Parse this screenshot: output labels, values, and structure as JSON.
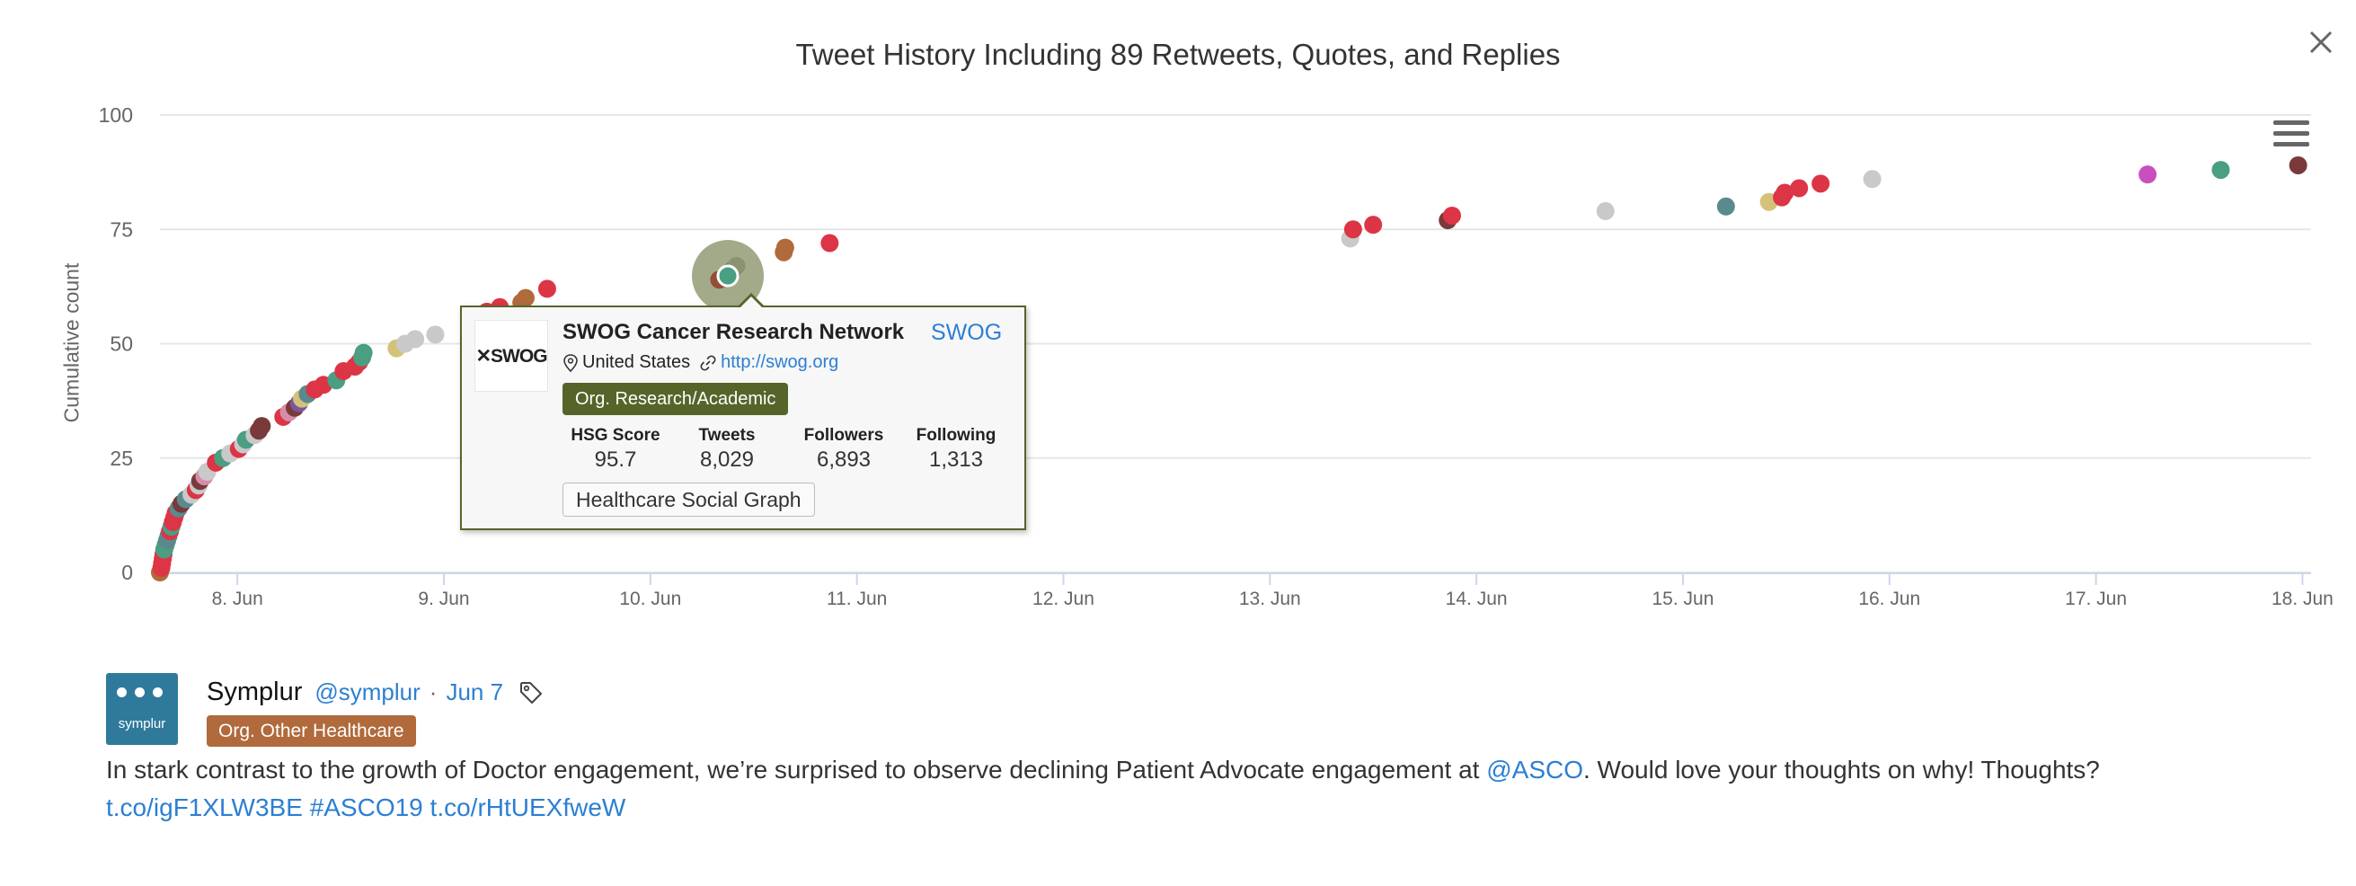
{
  "chart_data": {
    "type": "scatter",
    "title": "Tweet History Including 89 Retweets, Quotes, and Replies",
    "ylabel": "Cumulative count",
    "xlabel": "",
    "ylim": [
      0,
      100
    ],
    "xlim": [
      "2019-06-07 15:00",
      "2019-06-18 01:00"
    ],
    "y_ticks": [
      "0",
      "25",
      "50",
      "75",
      "100"
    ],
    "x_ticks": [
      "8. Jun",
      "9. Jun",
      "10. Jun",
      "11. Jun",
      "12. Jun",
      "13. Jun",
      "14. Jun",
      "15. Jun",
      "16. Jun",
      "17. Jun",
      "18. Jun"
    ],
    "grid": true,
    "highlighted_point": {
      "x": "2019-06-10 09:00",
      "y": 66
    },
    "points": [
      {
        "x": "2019-06-07 15:00",
        "y": 0,
        "color": "#b06a3b"
      },
      {
        "x": "2019-06-07 15:10",
        "y": 1,
        "color": "#dc3545"
      },
      {
        "x": "2019-06-07 15:15",
        "y": 2,
        "color": "#dc3545"
      },
      {
        "x": "2019-06-07 15:20",
        "y": 3,
        "color": "#dc3545"
      },
      {
        "x": "2019-06-07 15:25",
        "y": 4,
        "color": "#dc3545"
      },
      {
        "x": "2019-06-07 15:30",
        "y": 5,
        "color": "#4a9e82"
      },
      {
        "x": "2019-06-07 15:40",
        "y": 6,
        "color": "#4a9e82"
      },
      {
        "x": "2019-06-07 15:50",
        "y": 7,
        "color": "#5a8a8d"
      },
      {
        "x": "2019-06-07 16:00",
        "y": 8,
        "color": "#5a8a8d"
      },
      {
        "x": "2019-06-07 16:10",
        "y": 9,
        "color": "#dc3545"
      },
      {
        "x": "2019-06-07 16:20",
        "y": 10,
        "color": "#4a9e82"
      },
      {
        "x": "2019-06-07 16:30",
        "y": 11,
        "color": "#dc3545"
      },
      {
        "x": "2019-06-07 16:40",
        "y": 12,
        "color": "#dc3545"
      },
      {
        "x": "2019-06-07 16:50",
        "y": 13,
        "color": "#dc3545"
      },
      {
        "x": "2019-06-07 17:10",
        "y": 14,
        "color": "#5a8a8d"
      },
      {
        "x": "2019-06-07 17:30",
        "y": 15,
        "color": "#7a3a3a"
      },
      {
        "x": "2019-06-07 18:00",
        "y": 16,
        "color": "#5a8a8d"
      },
      {
        "x": "2019-06-07 18:40",
        "y": 17,
        "color": "#c9c9c9"
      },
      {
        "x": "2019-06-07 19:10",
        "y": 18,
        "color": "#dc3545"
      },
      {
        "x": "2019-06-07 19:30",
        "y": 19,
        "color": "#c9c9c9"
      },
      {
        "x": "2019-06-07 19:40",
        "y": 20,
        "color": "#7a3a3a"
      },
      {
        "x": "2019-06-07 20:10",
        "y": 21,
        "color": "#d58da8"
      },
      {
        "x": "2019-06-07 20:30",
        "y": 22,
        "color": "#c9c9c9"
      },
      {
        "x": "2019-06-07 21:30",
        "y": 24,
        "color": "#dc3545"
      },
      {
        "x": "2019-06-07 22:20",
        "y": 25,
        "color": "#4a9e82"
      },
      {
        "x": "2019-06-07 23:10",
        "y": 26,
        "color": "#c9c9c9"
      },
      {
        "x": "2019-06-08 00:10",
        "y": 27,
        "color": "#dc3545"
      },
      {
        "x": "2019-06-08 00:40",
        "y": 28,
        "color": "#c9c9c9"
      },
      {
        "x": "2019-06-08 01:00",
        "y": 29,
        "color": "#4a9e82"
      },
      {
        "x": "2019-06-08 02:00",
        "y": 30,
        "color": "#c9c9c9"
      },
      {
        "x": "2019-06-08 02:30",
        "y": 31,
        "color": "#7a3a3a"
      },
      {
        "x": "2019-06-08 02:50",
        "y": 32,
        "color": "#7a3a3a"
      },
      {
        "x": "2019-06-08 05:20",
        "y": 34,
        "color": "#dc3545"
      },
      {
        "x": "2019-06-08 06:00",
        "y": 35,
        "color": "#d58da8"
      },
      {
        "x": "2019-06-08 06:40",
        "y": 36,
        "color": "#7a3a3a"
      },
      {
        "x": "2019-06-08 07:10",
        "y": 37,
        "color": "#7a55a0"
      },
      {
        "x": "2019-06-08 07:30",
        "y": 38,
        "color": "#d4c27a"
      },
      {
        "x": "2019-06-08 08:10",
        "y": 39,
        "color": "#5a8a8d"
      },
      {
        "x": "2019-06-08 09:00",
        "y": 40,
        "color": "#dc3545"
      },
      {
        "x": "2019-06-08 10:00",
        "y": 41,
        "color": "#dc3545"
      },
      {
        "x": "2019-06-08 11:30",
        "y": 42,
        "color": "#4a9e82"
      },
      {
        "x": "2019-06-08 12:20",
        "y": 44,
        "color": "#dc3545"
      },
      {
        "x": "2019-06-08 13:40",
        "y": 45,
        "color": "#dc3545"
      },
      {
        "x": "2019-06-08 14:10",
        "y": 46,
        "color": "#dc3545"
      },
      {
        "x": "2019-06-08 14:30",
        "y": 47,
        "color": "#4a9e82"
      },
      {
        "x": "2019-06-08 14:40",
        "y": 48,
        "color": "#4a9e82"
      },
      {
        "x": "2019-06-08 18:30",
        "y": 49,
        "color": "#d4c27a"
      },
      {
        "x": "2019-06-08 19:30",
        "y": 50,
        "color": "#c9c9c9"
      },
      {
        "x": "2019-06-08 20:40",
        "y": 51,
        "color": "#c9c9c9"
      },
      {
        "x": "2019-06-08 23:00",
        "y": 52,
        "color": "#c9c9c9"
      },
      {
        "x": "2019-06-09 05:00",
        "y": 57,
        "color": "#dc3545"
      },
      {
        "x": "2019-06-09 06:30",
        "y": 58,
        "color": "#dc3545"
      },
      {
        "x": "2019-06-09 09:00",
        "y": 59,
        "color": "#b06a3b"
      },
      {
        "x": "2019-06-09 09:30",
        "y": 60,
        "color": "#b06a3b"
      },
      {
        "x": "2019-06-09 12:00",
        "y": 62,
        "color": "#dc3545"
      },
      {
        "x": "2019-06-10 08:00",
        "y": 64,
        "color": "#dc3545"
      },
      {
        "x": "2019-06-10 09:00",
        "y": 65,
        "color": "#4a9e82"
      },
      {
        "x": "2019-06-10 09:30",
        "y": 66,
        "color": "#4a9e82"
      },
      {
        "x": "2019-06-10 10:00",
        "y": 67,
        "color": "#c9c9c9"
      },
      {
        "x": "2019-06-10 15:30",
        "y": 70,
        "color": "#b06a3b"
      },
      {
        "x": "2019-06-10 15:40",
        "y": 71,
        "color": "#b06a3b"
      },
      {
        "x": "2019-06-10 20:50",
        "y": 72,
        "color": "#dc3545"
      },
      {
        "x": "2019-06-13 09:20",
        "y": 73,
        "color": "#c9c9c9"
      },
      {
        "x": "2019-06-13 09:40",
        "y": 75,
        "color": "#dc3545"
      },
      {
        "x": "2019-06-13 12:00",
        "y": 76,
        "color": "#dc3545"
      },
      {
        "x": "2019-06-13 20:40",
        "y": 77,
        "color": "#7a3a3a"
      },
      {
        "x": "2019-06-13 21:10",
        "y": 78,
        "color": "#dc3545"
      },
      {
        "x": "2019-06-14 15:00",
        "y": 79,
        "color": "#c9c9c9"
      },
      {
        "x": "2019-06-15 05:00",
        "y": 80,
        "color": "#5a8a8d"
      },
      {
        "x": "2019-06-15 10:00",
        "y": 81,
        "color": "#d4c27a"
      },
      {
        "x": "2019-06-15 11:30",
        "y": 82,
        "color": "#dc3545"
      },
      {
        "x": "2019-06-15 11:50",
        "y": 83,
        "color": "#dc3545"
      },
      {
        "x": "2019-06-15 13:30",
        "y": 84,
        "color": "#dc3545"
      },
      {
        "x": "2019-06-15 16:00",
        "y": 85,
        "color": "#dc3545"
      },
      {
        "x": "2019-06-15 22:00",
        "y": 86,
        "color": "#c9c9c9"
      },
      {
        "x": "2019-06-17 06:00",
        "y": 87,
        "color": "#c94fbf"
      },
      {
        "x": "2019-06-17 14:30",
        "y": 88,
        "color": "#4a9e82"
      },
      {
        "x": "2019-06-17 23:30",
        "y": 89,
        "color": "#7a3a3a"
      }
    ]
  },
  "tooltip": {
    "logo_text": "✕SWOG",
    "name": "SWOG Cancer Research Network",
    "handle": "SWOG",
    "location": "United States",
    "url": "http://swog.org",
    "category": "Org. Research/Academic",
    "category_color": "#55652a",
    "stats": [
      {
        "label": "HSG Score",
        "value": "95.7"
      },
      {
        "label": "Tweets",
        "value": "8,029"
      },
      {
        "label": "Followers",
        "value": "6,893"
      },
      {
        "label": "Following",
        "value": "1,313"
      }
    ],
    "button_label": "Healthcare Social Graph"
  },
  "tweet": {
    "avatar_label": "symplur",
    "author_name": "Symplur",
    "author_handle": "@symplur",
    "separator": "·",
    "date": "Jun 7",
    "category": "Org. Other Healthcare",
    "category_color": "#b06a3b",
    "text_before": "In stark contrast to the growth of Doctor engagement, we’re surprised to observe declining Patient Advocate engagement at ",
    "mention": "@ASCO",
    "text_after": ". Would love your thoughts on why! Thoughts?",
    "link1": "t.co/igF1XLW3BE",
    "hashtag": "#ASCO19",
    "link2": "t.co/rHtUEXfweW"
  },
  "icons": {
    "close": "close-icon",
    "menu": "hamburger-menu-icon",
    "location": "map-pin-icon",
    "link": "link-icon",
    "tag": "tag-icon"
  }
}
